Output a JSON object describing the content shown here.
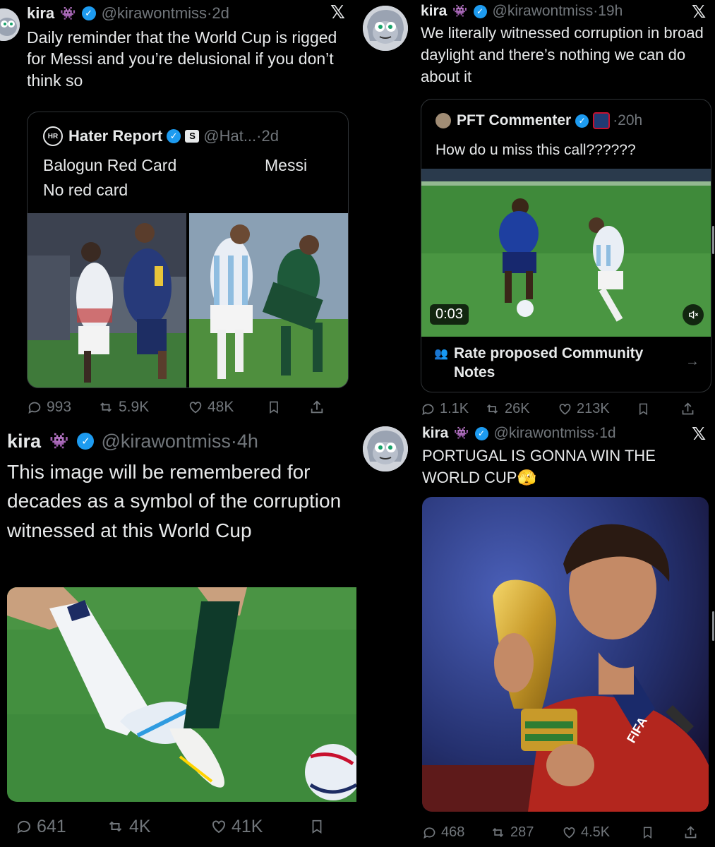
{
  "colors": {
    "background": "#000000",
    "text": "#e7e9ea",
    "muted": "#71767b",
    "verified": "#1d9bf0",
    "border": "#2f3336"
  },
  "post1": {
    "name": "kira",
    "handle": "@kirawontmiss",
    "time": "·2d",
    "text": "Daily reminder that the World Cup is rigged for Messi and you’re delusional if you don’t think so",
    "quote": {
      "name": "Hater Report",
      "handle": "@Hat...",
      "time": "·2d",
      "left_caption": "Balogun Red Card",
      "left_caption2": "No red card",
      "right_caption": "Messi"
    },
    "stats": {
      "replies": "993",
      "reposts": "5.9K",
      "likes": "48K"
    }
  },
  "post2": {
    "name": "kira",
    "handle": "@kirawontmiss",
    "time": "·19h",
    "text": "We literally witnessed corruption in broad daylight and there’s nothing we can do about it",
    "quote": {
      "name": "PFT Commenter",
      "time": "·20h",
      "text": "How do u miss this call??????",
      "video_time": "0:03",
      "notes_label": "Rate proposed Community Notes"
    },
    "stats": {
      "replies": "1.1K",
      "reposts": "26K",
      "likes": "213K"
    }
  },
  "post3": {
    "name": "kira",
    "handle": "@kirawontmiss",
    "time": "·4h",
    "text": "This image will be remembered for decades as a symbol of the corruption witnessed at this World Cup",
    "stats": {
      "replies": "641",
      "reposts": "4K",
      "likes": "41K"
    }
  },
  "post4": {
    "name": "kira",
    "handle": "@kirawontmiss",
    "time": "·1d",
    "text": "PORTUGAL IS GONNA WIN THE WORLD CUP",
    "emoji": "🫣",
    "image_text": "FIFA",
    "stats": {
      "replies": "468",
      "reposts": "287",
      "likes": "4.5K"
    }
  },
  "icons": {
    "badge": "verified-badge-icon",
    "x": "x-logo-icon",
    "reply": "reply-icon",
    "repost": "repost-icon",
    "like": "heart-icon",
    "bookmark": "bookmark-icon",
    "share": "share-icon"
  },
  "glyphs": {
    "check": "✓",
    "x": "𝕏",
    "arrow": "→",
    "emoji_alien": "👾"
  }
}
